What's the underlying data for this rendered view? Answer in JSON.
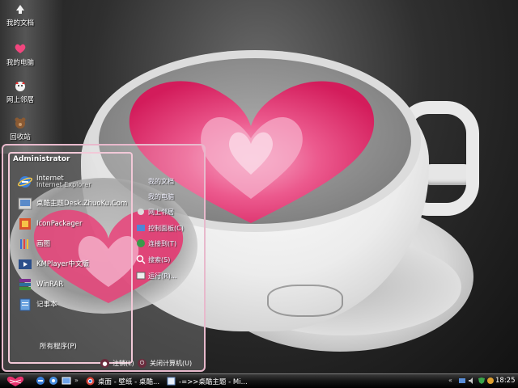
{
  "desktop": {
    "icons": [
      {
        "label": "我的文档",
        "icon": "my-documents-icon"
      },
      {
        "label": "我的电脑",
        "icon": "my-computer-icon"
      },
      {
        "label": "网上邻居",
        "icon": "network-places-icon"
      },
      {
        "label": "回收站",
        "icon": "recycle-bin-icon"
      }
    ]
  },
  "start_menu": {
    "user": "Administrator",
    "programs": [
      {
        "label": "Internet",
        "sublabel": "Internet Explorer",
        "icon": "internet-explorer-icon"
      },
      {
        "label": "桌酷主题Desk.ZhuoKu.Com",
        "icon": "zhuoku-icon"
      },
      {
        "label": "IconPackager",
        "icon": "iconpackager-icon"
      },
      {
        "label": "画图",
        "icon": "paint-icon"
      },
      {
        "label": "KMPlayer中文版",
        "icon": "kmplayer-icon"
      },
      {
        "label": "WinRAR",
        "icon": "winrar-icon"
      },
      {
        "label": "记事本",
        "icon": "notepad-icon"
      }
    ],
    "all_programs": "所有程序(P)",
    "places": [
      {
        "label": "我的文档",
        "icon": "folder-icon"
      },
      {
        "label": "我的电脑",
        "icon": "computer-icon"
      },
      {
        "label": "网上邻居",
        "icon": "network-icon"
      },
      {
        "label": "控制面板(C)",
        "icon": "control-panel-icon"
      },
      {
        "label": "连接到(T)",
        "icon": "connect-icon"
      },
      {
        "label": "搜索(S)",
        "icon": "search-icon"
      },
      {
        "label": "运行(R)...",
        "icon": "run-icon"
      }
    ],
    "logoff": "注销(L)",
    "shutdown": "关闭计算机(U)"
  },
  "taskbar": {
    "tasks": [
      {
        "label": "桌面 - 壁纸 - 桌酷...",
        "icon": "chrome-icon"
      },
      {
        "label": "-=>>桌酷主题 - Mi...",
        "icon": "window-icon"
      }
    ],
    "clock": "18:25"
  },
  "colors": {
    "menu_border": "#e8b9cc",
    "heart_pink": "#e8336f",
    "taskbar": "#141414"
  }
}
